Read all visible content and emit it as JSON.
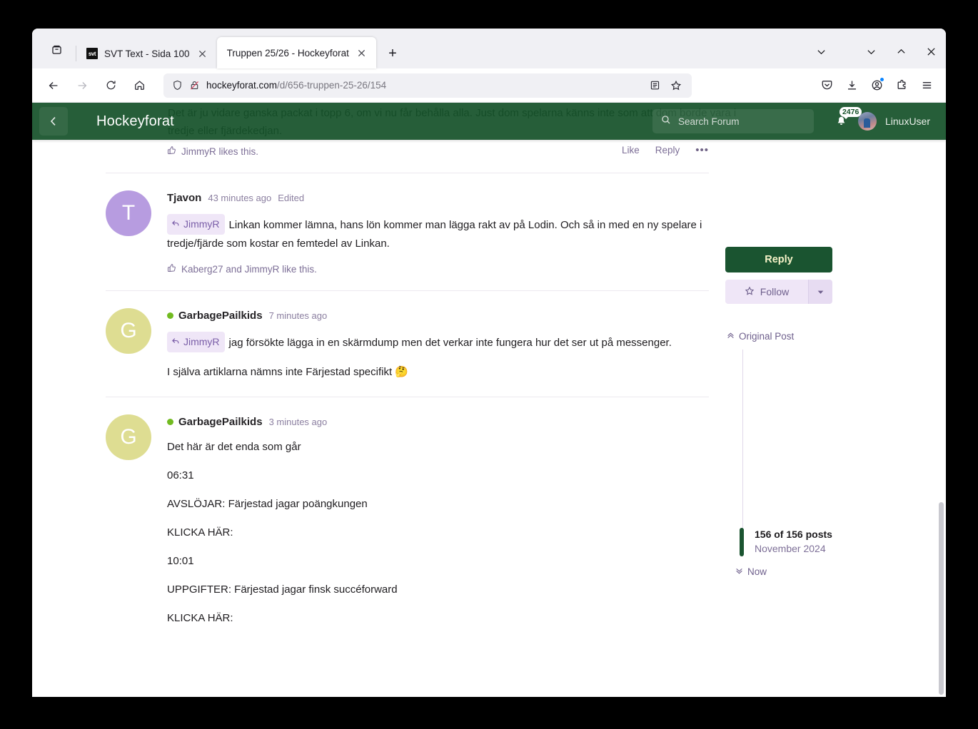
{
  "browser": {
    "tabs": [
      {
        "title": "SVT Text - Sida 100",
        "favicon_text": "svt",
        "favicon_name": "svt-favicon",
        "active": false
      },
      {
        "title": "Truppen 25/26 - Hockeyforat",
        "favicon_text": "",
        "favicon_name": "hockeyforat-favicon",
        "active": true
      }
    ],
    "new_tab_label": "+",
    "url": {
      "domain": "hockeyforat.com",
      "path": "/d/656-truppen-25-26/154"
    },
    "window_controls": {
      "minimize": "minimize",
      "maximize": "maximize",
      "close": "close",
      "tab_list": "list-all-tabs"
    }
  },
  "forum": {
    "brand": "Hockeyforat",
    "back_label": "back",
    "search": {
      "placeholder": "Search Forum"
    },
    "notifications": {
      "count": "2476"
    },
    "user": {
      "name": "LinuxUser"
    },
    "ghost_text": "Det är ju vidare ganska packat i topp 6, om vi nu får behålla alla. Just dom spelarna känns inte som att dom borde vara i tredje eller fjärdekedjan."
  },
  "posts": [
    {
      "id": "post-partial",
      "likes_text": "JimmyR likes this.",
      "actions": {
        "like": "Like",
        "reply": "Reply",
        "more": "•••"
      }
    },
    {
      "id": "post-tjavon",
      "author": "Tjavon",
      "avatar_letter": "T",
      "avatar_color": "#b79ce0",
      "online": false,
      "time": "43 minutes ago",
      "edited": "Edited",
      "mention": "JimmyR",
      "paragraphs": [
        "Linkan kommer lämna, hans lön kommer man lägga rakt av på Lodin. Och så in med en ny spelare i tredje/fjärde som kostar en femtedel av Linkan."
      ],
      "likes_text": "Kaberg27 and JimmyR like this."
    },
    {
      "id": "post-gpk-1",
      "author": "GarbagePailkids",
      "avatar_letter": "G",
      "avatar_color": "#dedd92",
      "online": true,
      "time": "7 minutes ago",
      "mention": "JimmyR",
      "paragraphs": [
        "jag försökte lägga in en skärmdump men det verkar inte fungera hur det ser ut på messenger.",
        "I själva artiklarna nämns inte Färjestad specifikt 🤔"
      ]
    },
    {
      "id": "post-gpk-2",
      "author": "GarbagePailkids",
      "avatar_letter": "G",
      "avatar_color": "#dedd92",
      "online": true,
      "time": "3 minutes ago",
      "paragraphs": [
        "Det här är det enda som går",
        "06:31",
        "AVSLÖJAR: Färjestad jagar poängkungen",
        "KLICKA HÄR:",
        "10:01",
        "UPPGIFTER: Färjestad jagar finsk succéforward",
        "KLICKA HÄR:"
      ]
    }
  ],
  "sidebar": {
    "reply_button": "Reply",
    "follow_button": "Follow",
    "original_post": "Original Post",
    "post_count": "156 of 156 posts",
    "post_date": "November 2024",
    "now_label": "Now"
  },
  "colors": {
    "brand_green": "#16522a",
    "button_green": "#1a5430",
    "accent_purple": "#7a5ea8",
    "online_green": "#72bb21"
  }
}
